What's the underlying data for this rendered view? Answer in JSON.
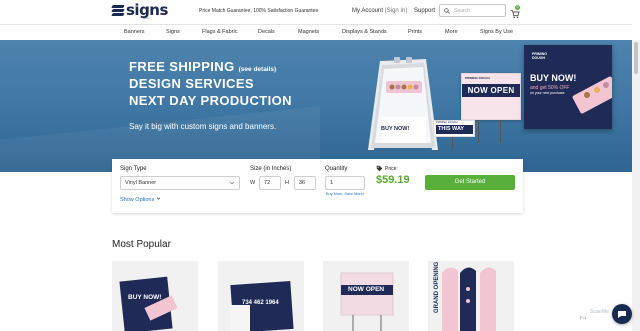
{
  "header": {
    "logo_text": "signs",
    "logo_sub": ".com",
    "tagline": "Price Match Guarantee, 100% Satisfaction Guarantee",
    "account_label": "My Account",
    "signin_label": "(Sign In)",
    "support_label": "Support",
    "search_placeholder": "Search",
    "cart_count": "0"
  },
  "nav": {
    "items": [
      "Banners",
      "Signs",
      "Flags & Fabric",
      "Decals",
      "Magnets",
      "Displays & Stands",
      "Prints",
      "More",
      "Signs By Use"
    ]
  },
  "hero": {
    "line1": "FREE SHIPPING",
    "line1_note": "(see details)",
    "line2": "DESIGN SERVICES",
    "line3": "NEXT DAY PRODUCTION",
    "subtitle": "Say it big with custom signs and banners.",
    "aframe_text": "BUY NOW!",
    "now_open_text": "NOW OPEN",
    "this_way_text": "THIS WAY",
    "banner_buy": "BUY NOW!",
    "banner_off": "and get 50% OFF",
    "banner_next": "on your next purchase",
    "brand_small": "PRIMING DOUGH"
  },
  "config": {
    "sign_type_label": "Sign Type",
    "sign_type_value": "Vinyl Banner",
    "size_label": "Size (in Inches)",
    "width_prefix": "W",
    "width_value": "72",
    "height_prefix": "H",
    "height_value": "36",
    "quantity_label": "Quantity",
    "quantity_value": "1",
    "buy_more": "Buy More, Save More!",
    "price_label": "Price:",
    "price_value": "$59.19",
    "cta_label": "Get Started",
    "show_options": "Show Options"
  },
  "popular": {
    "title": "Most Popular",
    "card1_text": "BUY NOW!",
    "card2_text": "734 462 1964",
    "card3_text": "NOW OPEN",
    "card4_text": "GRAND OPENING"
  },
  "chat": {
    "label": "ScanMe",
    "page": "P-1"
  },
  "colors": {
    "brand_navy": "#1a2a4f",
    "hero_blue": "#3e76a3",
    "cta_green": "#58b03a",
    "price_green": "#5aa832",
    "link_blue": "#1f6fbf"
  }
}
